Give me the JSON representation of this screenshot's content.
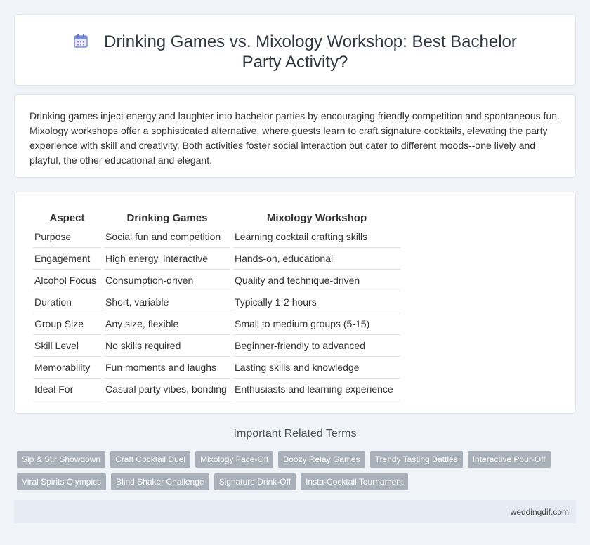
{
  "header": {
    "title": "Drinking Games vs. Mixology Workshop: Best Bachelor Party Activity?",
    "icon": "calendar-icon"
  },
  "intro": {
    "text": "Drinking games inject energy and laughter into bachelor parties by encouraging friendly competition and spontaneous fun. Mixology workshops offer a sophisticated alternative, where guests learn to craft signature cocktails, elevating the party experience with skill and creativity. Both activities foster social interaction but cater to different moods--one lively and playful, the other educational and elegant."
  },
  "comparison": {
    "headers": [
      "Aspect",
      "Drinking Games",
      "Mixology Workshop"
    ],
    "rows": [
      [
        "Purpose",
        "Social fun and competition",
        "Learning cocktail crafting skills"
      ],
      [
        "Engagement",
        "High energy, interactive",
        "Hands-on, educational"
      ],
      [
        "Alcohol Focus",
        "Consumption-driven",
        "Quality and technique-driven"
      ],
      [
        "Duration",
        "Short, variable",
        "Typically 1-2 hours"
      ],
      [
        "Group Size",
        "Any size, flexible",
        "Small to medium groups (5-15)"
      ],
      [
        "Skill Level",
        "No skills required",
        "Beginner-friendly to advanced"
      ],
      [
        "Memorability",
        "Fun moments and laughs",
        "Lasting skills and knowledge"
      ],
      [
        "Ideal For",
        "Casual party vibes, bonding",
        "Enthusiasts and learning experience"
      ]
    ]
  },
  "related": {
    "title": "Important Related Terms",
    "tags_row1": [
      "Sip & Stir Showdown",
      "Craft Cocktail Duel",
      "Mixology Face-Off",
      "Boozy Relay Games",
      "Trendy Tasting Battles",
      "Interactive Pour-Off"
    ],
    "tags_row2": [
      "Viral Spirits Olympics",
      "Blind Shaker Challenge",
      "Signature Drink-Off",
      "Insta-Cocktail Tournament"
    ]
  },
  "footer": {
    "site": "weddingdif.com"
  },
  "colors": {
    "background": "#f0f3f8",
    "tag": "#a9b0ba",
    "icon": "#7b8fd8"
  }
}
